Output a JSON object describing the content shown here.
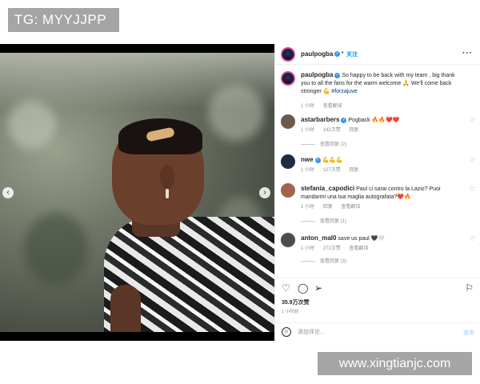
{
  "watermarks": {
    "top": "TG: MYYJJPP",
    "bottom": "www.xingtianjc.com"
  },
  "post": {
    "author": {
      "username": "paulpogba",
      "follow_label": "关注"
    },
    "more_label": "···",
    "caption": {
      "username": "paulpogba",
      "text": "So happy to be back with my team , big thank you to all the fans for the warm welcome 🙏 We'll come back stronger 💪 ",
      "hashtag": "#forzajuve",
      "time": "1 小时",
      "translation": "查看翻译"
    },
    "comments": [
      {
        "username": "astarbarbers",
        "verified": true,
        "text": "Pogback 🔥🔥❤️❤️",
        "time": "1 小时",
        "likes": "142次赞",
        "reply": "回复",
        "view_replies": "查看回复 (2)"
      },
      {
        "username": "nwe",
        "verified": true,
        "text": "💪💪💪",
        "time": "1 小时",
        "likes": "127次赞",
        "reply": "回复",
        "view_replies": ""
      },
      {
        "username": "stefania_capodici",
        "verified": false,
        "text": "Paul ci sarai contro la Lazio? Puoi mandarmi una tua maglia autografata?❤️🔥",
        "time": "1 小时",
        "likes": "回复",
        "reply": "查看翻译",
        "view_replies": "查看回复 (1)"
      },
      {
        "username": "anton_mal0",
        "verified": false,
        "text": "save us paul 🖤🤍",
        "time": "1 小时",
        "likes": "272次赞",
        "reply": "查看翻译",
        "view_replies": "查看回复 (3)"
      }
    ],
    "likes_count": "35.9万次赞",
    "post_time": "1 小时前",
    "add_comment_placeholder": "添加评论...",
    "post_button": "发布"
  },
  "colors": {
    "link_blue": "#0095f6",
    "verified_blue": "#3897f0",
    "watermark_gray": "#a5a5a5"
  },
  "icons": [
    "heart-icon",
    "comment-icon",
    "share-icon",
    "bookmark-icon",
    "emoji-icon",
    "more-icon",
    "chevron-left-icon",
    "chevron-right-icon"
  ]
}
